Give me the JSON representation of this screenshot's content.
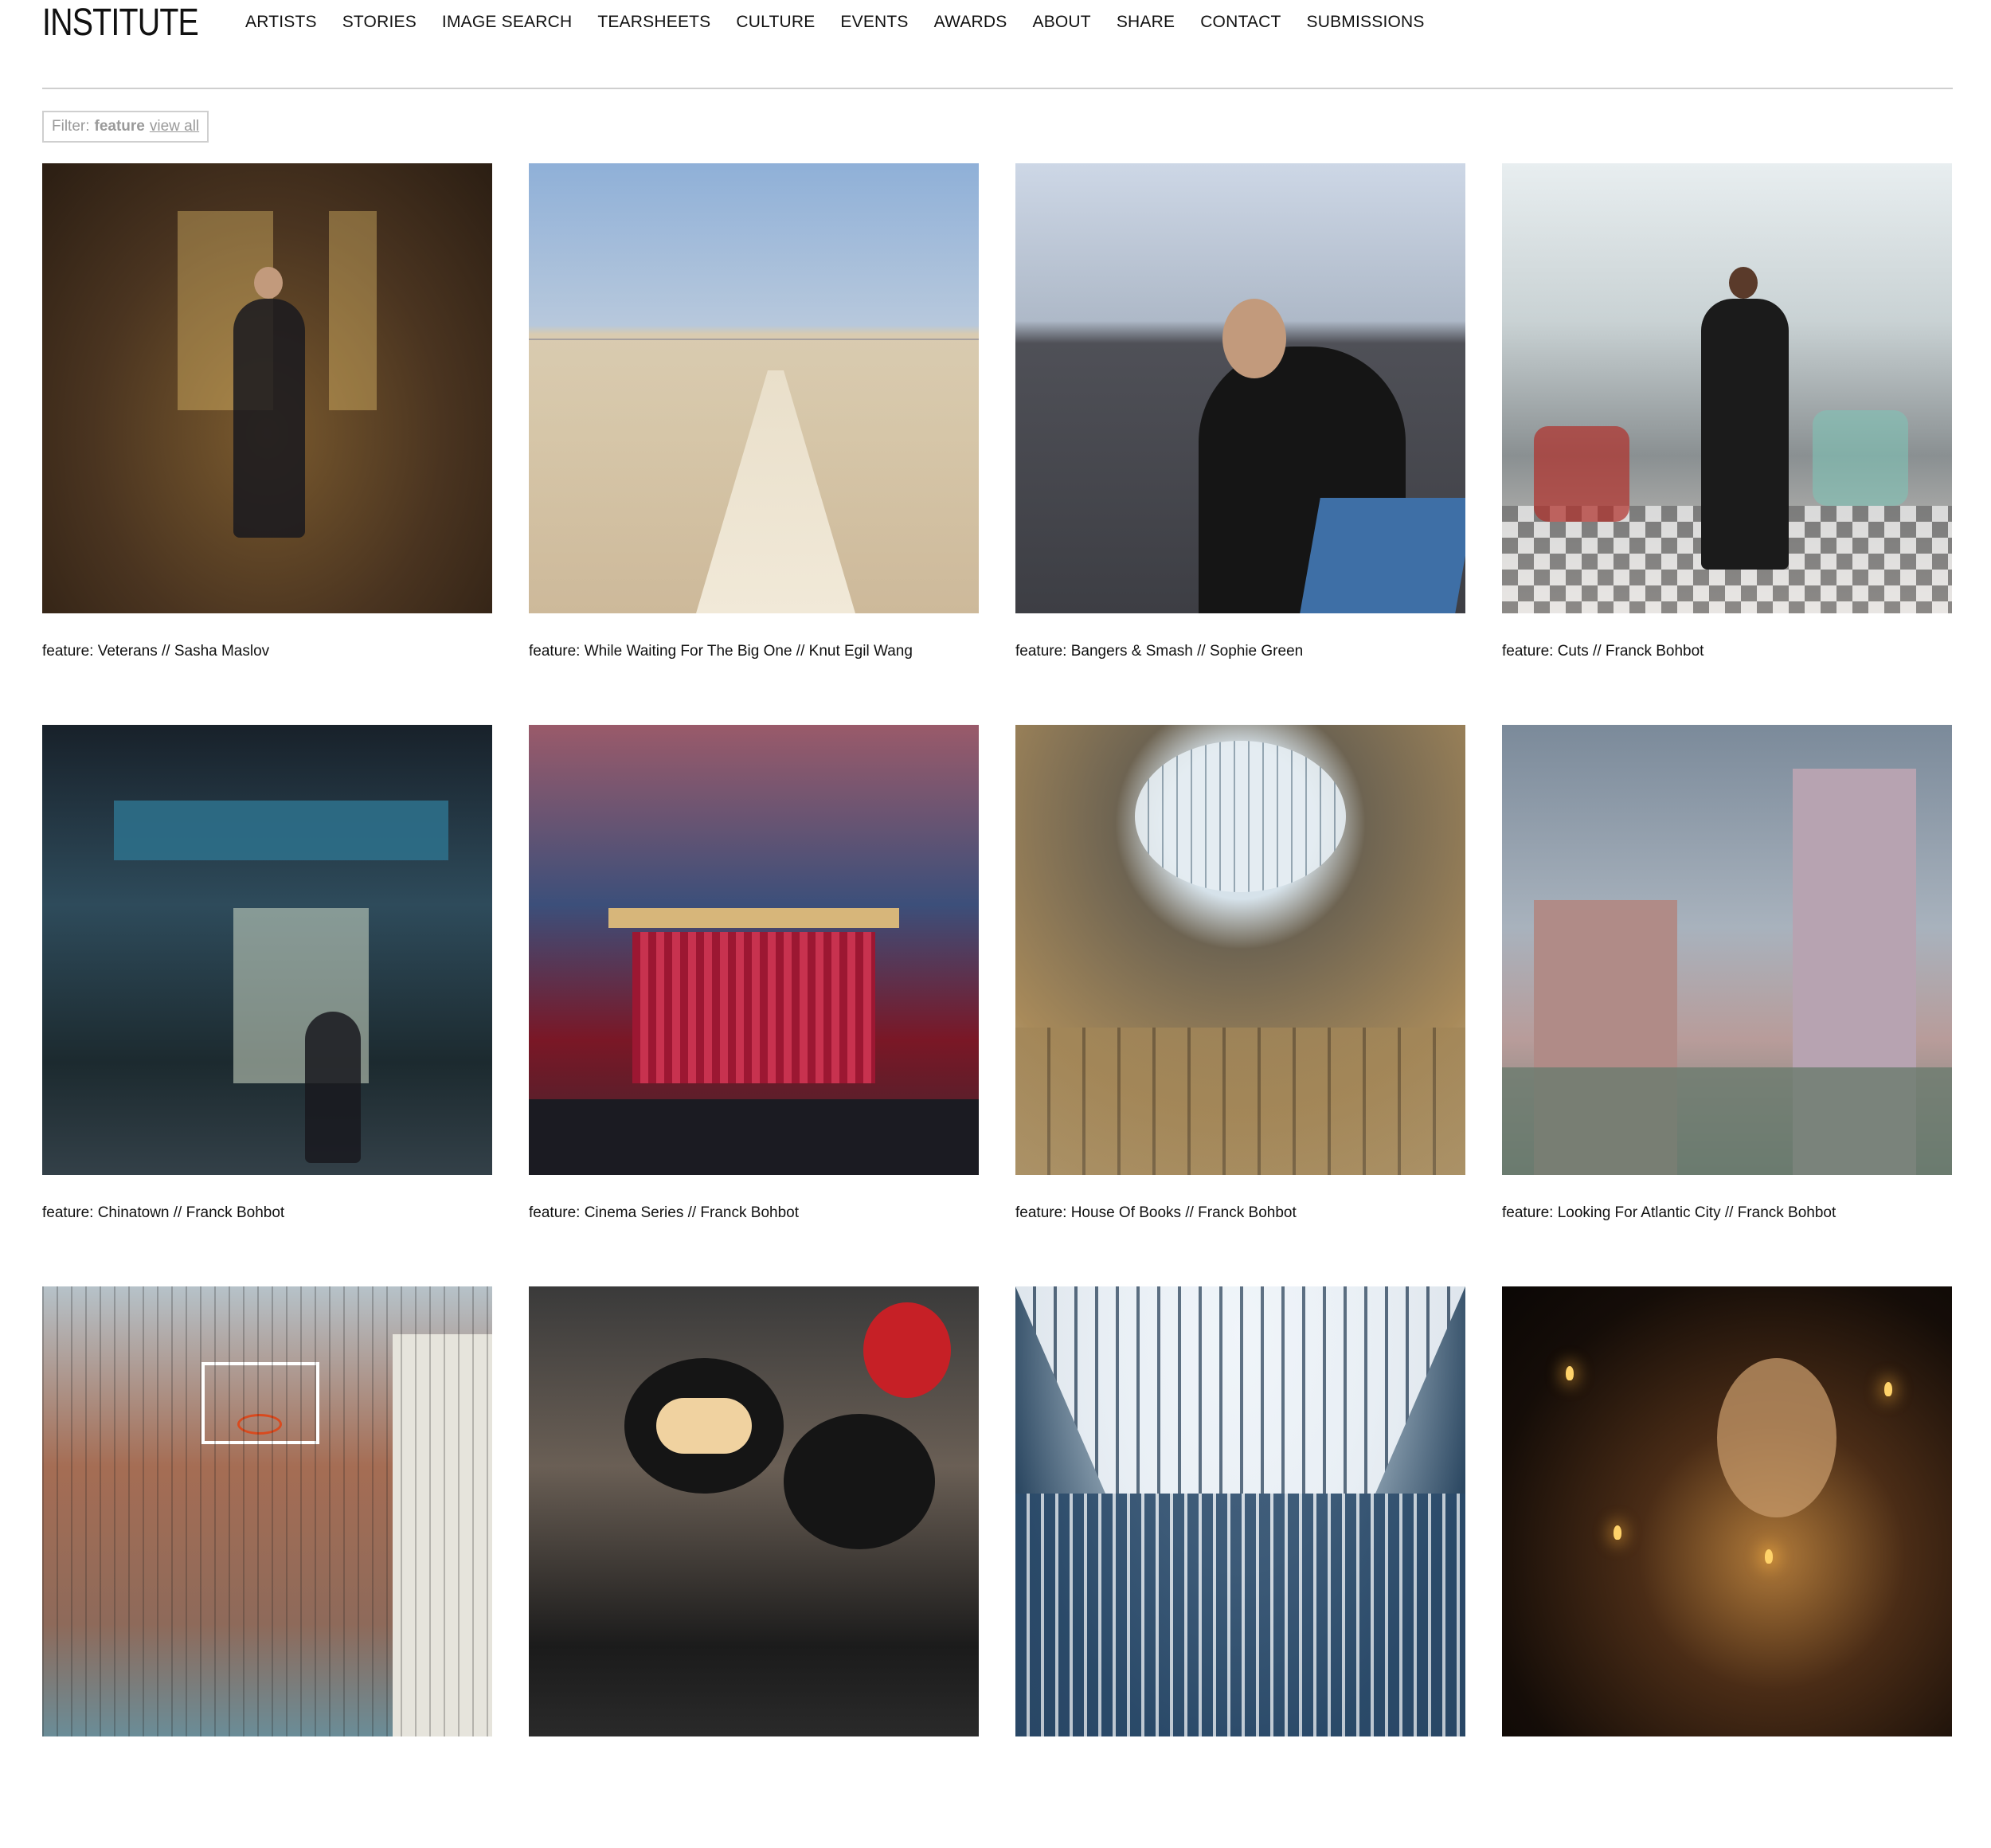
{
  "brand": {
    "logo": "INSTITUTE"
  },
  "nav": {
    "items": [
      "ARTISTS",
      "STORIES",
      "IMAGE SEARCH",
      "TEARSHEETS",
      "CULTURE",
      "EVENTS",
      "AWARDS",
      "ABOUT",
      "SHARE",
      "CONTACT",
      "SUBMISSIONS"
    ]
  },
  "filter": {
    "label": "Filter:",
    "value": "feature",
    "view_all": "view all"
  },
  "grid": {
    "items": [
      {
        "caption": "feature: Veterans // Sasha Maslov"
      },
      {
        "caption": "feature: While Waiting For The Big One // Knut Egil Wang"
      },
      {
        "caption": "feature: Bangers & Smash // Sophie Green"
      },
      {
        "caption": "feature: Cuts // Franck Bohbot"
      },
      {
        "caption": "feature: Chinatown // Franck Bohbot"
      },
      {
        "caption": "feature: Cinema Series // Franck Bohbot"
      },
      {
        "caption": "feature: House Of Books // Franck Bohbot"
      },
      {
        "caption": "feature: Looking For Atlantic City // Franck Bohbot"
      },
      {
        "caption": ""
      },
      {
        "caption": ""
      },
      {
        "caption": ""
      },
      {
        "caption": ""
      }
    ]
  }
}
